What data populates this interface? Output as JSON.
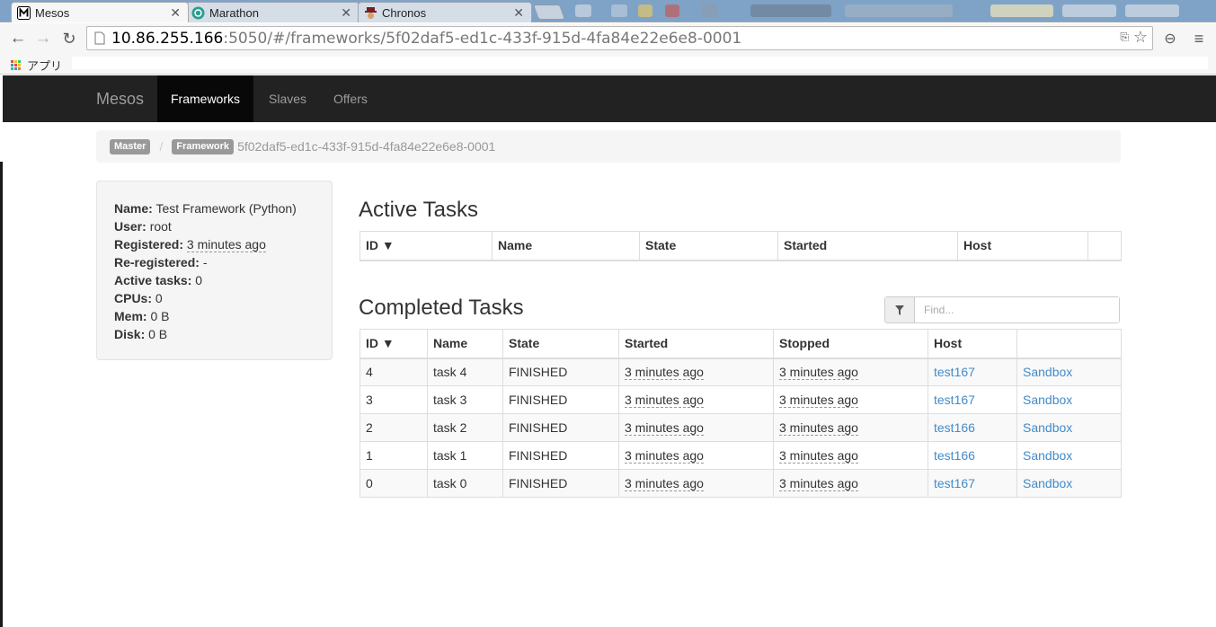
{
  "browser": {
    "tabs": [
      {
        "title": "Mesos",
        "active": true
      },
      {
        "title": "Marathon",
        "active": false
      },
      {
        "title": "Chronos",
        "active": false
      }
    ],
    "url_host": "10.86.255.166",
    "url_path": ":5050/#/frameworks/5f02daf5-ed1c-433f-915d-4fa84e22e6e8-0001",
    "bookmarks_apps_label": "アプリ"
  },
  "nav": {
    "brand": "Mesos",
    "items": [
      "Frameworks",
      "Slaves",
      "Offers"
    ],
    "active": "Frameworks"
  },
  "breadcrumb": {
    "master": "Master",
    "framework": "Framework",
    "framework_id": "5f02daf5-ed1c-433f-915d-4fa84e22e6e8-0001"
  },
  "info": {
    "name_label": "Name:",
    "name": "Test Framework (Python)",
    "user_label": "User:",
    "user": "root",
    "registered_label": "Registered:",
    "registered": "3 minutes ago",
    "reregistered_label": "Re-registered:",
    "reregistered": "-",
    "active_tasks_label": "Active tasks:",
    "active_tasks": "0",
    "cpus_label": "CPUs:",
    "cpus": "0",
    "mem_label": "Mem:",
    "mem": "0 B",
    "disk_label": "Disk:",
    "disk": "0 B"
  },
  "active_tasks": {
    "title": "Active Tasks",
    "columns": [
      "ID ▼",
      "Name",
      "State",
      "Started",
      "Host",
      ""
    ]
  },
  "completed_tasks": {
    "title": "Completed Tasks",
    "find_placeholder": "Find...",
    "columns": [
      "ID ▼",
      "Name",
      "State",
      "Started",
      "Stopped",
      "Host",
      ""
    ],
    "rows": [
      {
        "id": "4",
        "name": "task 4",
        "state": "FINISHED",
        "started": "3 minutes ago",
        "stopped": "3 minutes ago",
        "host": "test167",
        "sandbox": "Sandbox"
      },
      {
        "id": "3",
        "name": "task 3",
        "state": "FINISHED",
        "started": "3 minutes ago",
        "stopped": "3 minutes ago",
        "host": "test167",
        "sandbox": "Sandbox"
      },
      {
        "id": "2",
        "name": "task 2",
        "state": "FINISHED",
        "started": "3 minutes ago",
        "stopped": "3 minutes ago",
        "host": "test166",
        "sandbox": "Sandbox"
      },
      {
        "id": "1",
        "name": "task 1",
        "state": "FINISHED",
        "started": "3 minutes ago",
        "stopped": "3 minutes ago",
        "host": "test166",
        "sandbox": "Sandbox"
      },
      {
        "id": "0",
        "name": "task 0",
        "state": "FINISHED",
        "started": "3 minutes ago",
        "stopped": "3 minutes ago",
        "host": "test167",
        "sandbox": "Sandbox"
      }
    ]
  },
  "colors": {
    "navbar": "#222222",
    "link": "#428bca",
    "label": "#999999"
  }
}
